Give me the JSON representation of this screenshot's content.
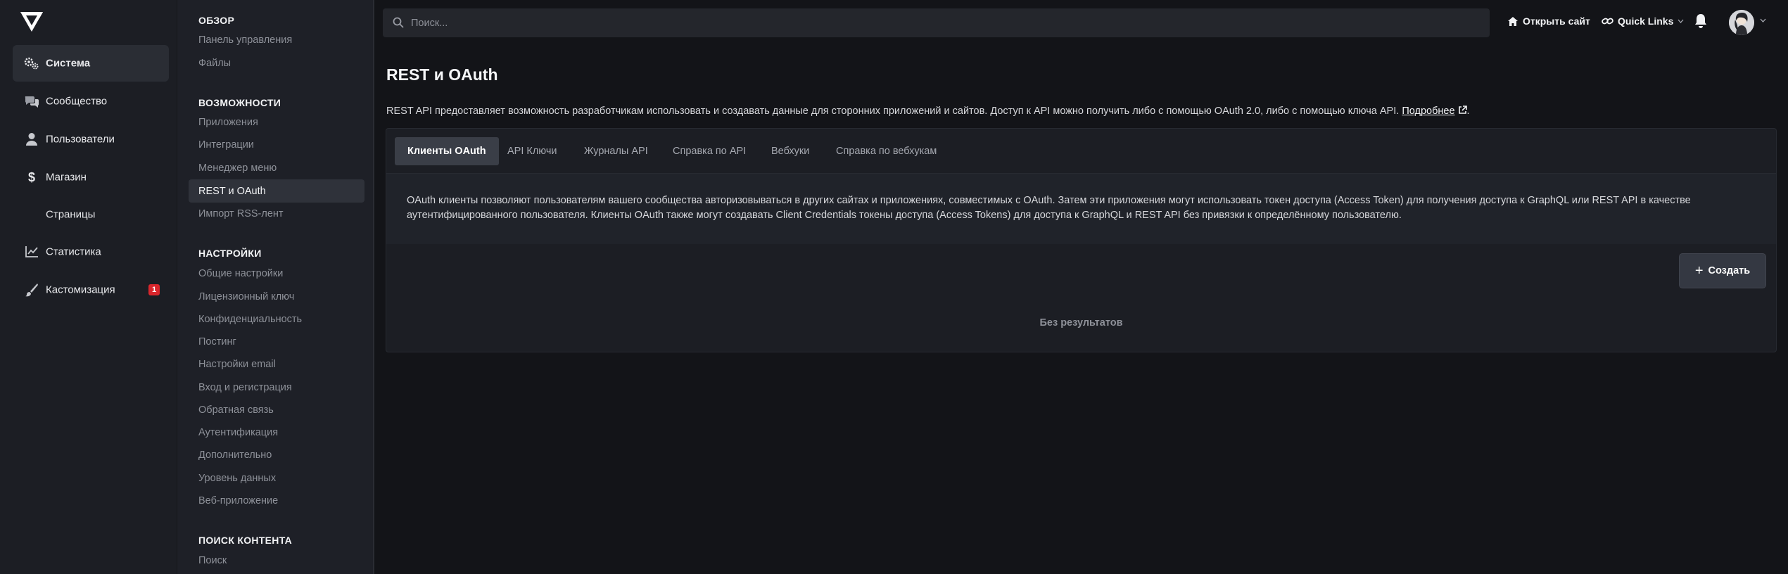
{
  "nav": {
    "items": [
      {
        "label": "Система",
        "icon": "gears-icon",
        "active": true
      },
      {
        "label": "Сообщество",
        "icon": "chat-icon"
      },
      {
        "label": "Пользователи",
        "icon": "user-icon"
      },
      {
        "label": "Магазин",
        "icon": "dollar-icon"
      },
      {
        "label": "Страницы",
        "icon": ""
      },
      {
        "label": "Статистика",
        "icon": "chart-line-icon"
      },
      {
        "label": "Кастомизация",
        "icon": "paintbrush-icon",
        "badge": "1"
      }
    ]
  },
  "submenu": {
    "sections": [
      {
        "title": "ОБЗОР",
        "items": [
          "Панель управления",
          "Файлы"
        ]
      },
      {
        "title": "ВОЗМОЖНОСТИ",
        "items": [
          "Приложения",
          "Интеграции",
          "Менеджер меню",
          "REST и OAuth",
          "Импорт RSS-лент"
        ]
      },
      {
        "title": "НАСТРОЙКИ",
        "items": [
          "Общие настройки",
          "Лицензионный ключ",
          "Конфиденциальность",
          "Постинг",
          "Настройки email",
          "Вход и регистрация",
          "Обратная связь",
          "Аутентификация",
          "Дополнительно",
          "Уровень данных",
          "Веб-приложение"
        ]
      },
      {
        "title": "ПОИСК КОНТЕНТА",
        "items": [
          "Поиск"
        ]
      }
    ],
    "active": "REST и OAuth"
  },
  "topbar": {
    "search_placeholder": "Поиск...",
    "open_site": "Открыть сайт",
    "quick_links": "Quick Links"
  },
  "main": {
    "title": "REST и OAuth",
    "description": "REST API предоставляет возможность разработчикам использовать и создавать данные для сторонних приложений и сайтов. Доступ к API можно получить либо с помощью OAuth 2.0, либо с помощью ключа API.",
    "learn_more": "Подробнее",
    "tabs": [
      "Клиенты OAuth",
      "API Ключи",
      "Журналы API",
      "Справка по API",
      "Вебхуки",
      "Справка по вебхукам"
    ],
    "active_tab": "Клиенты OAuth",
    "info_text": "OAuth клиенты позволяют пользователям вашего сообщества авторизовываться в других сайтах и приложениях, совместимых с OAuth. Затем эти приложения могут использовать токен доступа (Access Token) для получения доступа к GraphQL или REST API в качестве аутентифицированного пользователя. Клиенты OAuth также могут создавать Client Credentials токены доступа (Access Tokens) для доступа к GraphQL и REST API без привязки к определённому пользователю.",
    "create_label": "Создать",
    "empty_label": "Без результатов"
  },
  "colors": {
    "background": "#131418",
    "nav": "#1c1e24",
    "submenu": "#1e2027",
    "badge": "#d9262c"
  }
}
